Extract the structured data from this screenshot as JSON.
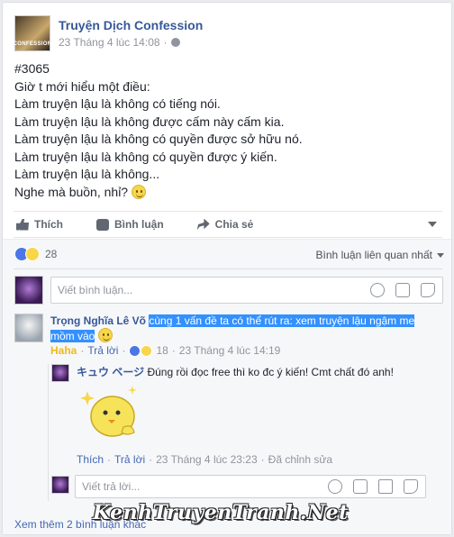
{
  "post": {
    "page_name": "Truyện Dịch Confession",
    "avatar_text": "CONFESSION",
    "timestamp": "23 Tháng 4 lúc 14:08",
    "lines": [
      "#3065",
      "Giờ t mới hiểu một điều:",
      "Làm truyện lậu là không có tiếng nói.",
      "Làm truyện lậu là không được cấm này cấm kia.",
      "Làm truyện lậu là không có quyền được sở hữu nó.",
      "Làm truyện lậu là không có quyền được ý kiến.",
      "Làm truyện lậu là không..."
    ],
    "last_line": "Nghe mà buồn, nhỉ?"
  },
  "actions": {
    "like": "Thích",
    "comment": "Bình luận",
    "share": "Chia sẻ"
  },
  "reactions": {
    "count": "28",
    "sort_label": "Bình luận liên quan nhất"
  },
  "comment_input": {
    "placeholder": "Viết bình luận..."
  },
  "comment1": {
    "author": "Trọng Nghĩa Lê Võ",
    "text_line1": "cùng 1 vấn đề ta có thể rút ra: xem truyện lậu ngậm me",
    "text_line2": "mồm vào",
    "reaction_label": "Haha",
    "reply_label": "Trả lời",
    "reaction_count": "18",
    "time": "23 Tháng 4 lúc 14:19"
  },
  "reply1": {
    "author": "キュウ ベージ",
    "text": "Đúng rồi đọc free thì ko đc ý kiến! Cmt chất đó anh!",
    "like_label": "Thích",
    "reply_label": "Trả lời",
    "time": "23 Tháng 4 lúc 23:23",
    "edited": "Đã chỉnh sửa"
  },
  "reply_input": {
    "placeholder": "Viết trả lời..."
  },
  "watermark": "KenhTruyenTranh.Net",
  "see_more": "Xem thêm 2 bình luận khác",
  "colors": {
    "link": "#365899",
    "highlight": "#3390ff",
    "haha": "#f0ba15"
  }
}
